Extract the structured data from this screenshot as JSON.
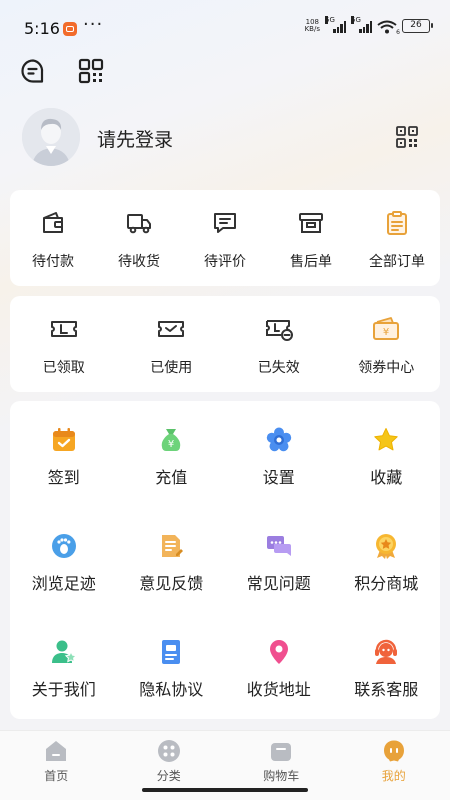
{
  "status_bar": {
    "time": "5:16",
    "dots": "···",
    "net_speed_value": "108",
    "net_speed_unit": "KB/s",
    "sig1_label": "5G",
    "sig2_label": "5G",
    "wifi_label": "6",
    "battery": "26"
  },
  "profile": {
    "login_prompt": "请先登录"
  },
  "orders": [
    {
      "label": "待付款",
      "icon": "wallet-icon"
    },
    {
      "label": "待收货",
      "icon": "delivery-truck-icon"
    },
    {
      "label": "待评价",
      "icon": "comment-icon"
    },
    {
      "label": "售后单",
      "icon": "archive-box-icon"
    },
    {
      "label": "全部订单",
      "icon": "clipboard-icon"
    }
  ],
  "coupons": [
    {
      "label": "已领取",
      "icon": "coupon-received-icon"
    },
    {
      "label": "已使用",
      "icon": "coupon-used-icon"
    },
    {
      "label": "已失效",
      "icon": "coupon-expired-icon"
    },
    {
      "label": "领券中心",
      "icon": "coupon-center-icon"
    }
  ],
  "services": [
    {
      "label": "签到",
      "icon": "calendar-checkin-icon"
    },
    {
      "label": "充值",
      "icon": "money-bag-icon"
    },
    {
      "label": "设置",
      "icon": "flower-settings-icon"
    },
    {
      "label": "收藏",
      "icon": "star-icon"
    },
    {
      "label": "浏览足迹",
      "icon": "footprint-icon"
    },
    {
      "label": "意见反馈",
      "icon": "feedback-icon"
    },
    {
      "label": "常见问题",
      "icon": "faq-chat-icon"
    },
    {
      "label": "积分商城",
      "icon": "medal-icon"
    },
    {
      "label": "关于我们",
      "icon": "user-star-icon"
    },
    {
      "label": "隐私协议",
      "icon": "document-icon"
    },
    {
      "label": "收货地址",
      "icon": "location-pin-icon"
    },
    {
      "label": "联系客服",
      "icon": "customer-service-icon"
    }
  ],
  "tabbar": [
    {
      "label": "首页",
      "icon": "home-icon",
      "active": false
    },
    {
      "label": "分类",
      "icon": "category-icon",
      "active": false
    },
    {
      "label": "购物车",
      "icon": "cart-icon",
      "active": false
    },
    {
      "label": "我的",
      "icon": "profile-face-icon",
      "active": true
    }
  ],
  "colors": {
    "accent": "#e8a23a",
    "status_app_icon": "#f26b2a",
    "inactive_tab_icon": "#b9bcc2"
  }
}
